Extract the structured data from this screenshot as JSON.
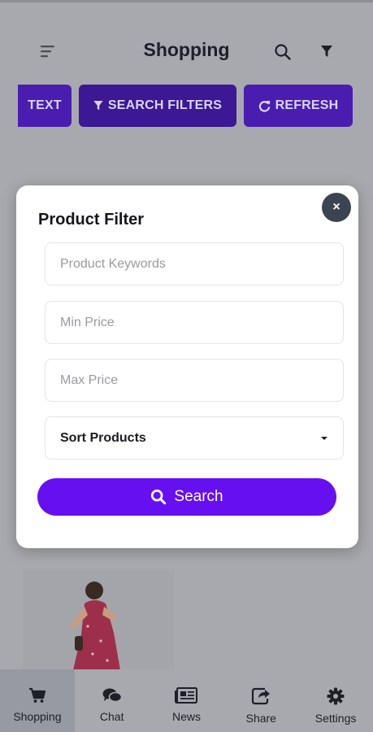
{
  "header": {
    "title": "Shopping"
  },
  "chips": [
    {
      "label": "TEXT"
    },
    {
      "label": "SEARCH FILTERS"
    },
    {
      "label": "REFRESH"
    }
  ],
  "modal": {
    "title": "Product Filter",
    "close_label": "×",
    "fields": {
      "keywords_placeholder": "Product Keywords",
      "min_price_placeholder": "Min Price",
      "max_price_placeholder": "Max Price"
    },
    "sort_label": "Sort Products",
    "search_label": "Search"
  },
  "bottom_nav": [
    {
      "label": "Shopping",
      "icon": "cart-icon",
      "active": true
    },
    {
      "label": "Chat",
      "icon": "chat-icon"
    },
    {
      "label": "News",
      "icon": "newspaper-icon"
    },
    {
      "label": "Share",
      "icon": "share-icon"
    },
    {
      "label": "Settings",
      "icon": "gear-icon"
    }
  ],
  "colors": {
    "accent": "#6610f2",
    "chip": "#4a1db0",
    "overlay": "#a8a9ae",
    "close_button": "#3d4451"
  }
}
